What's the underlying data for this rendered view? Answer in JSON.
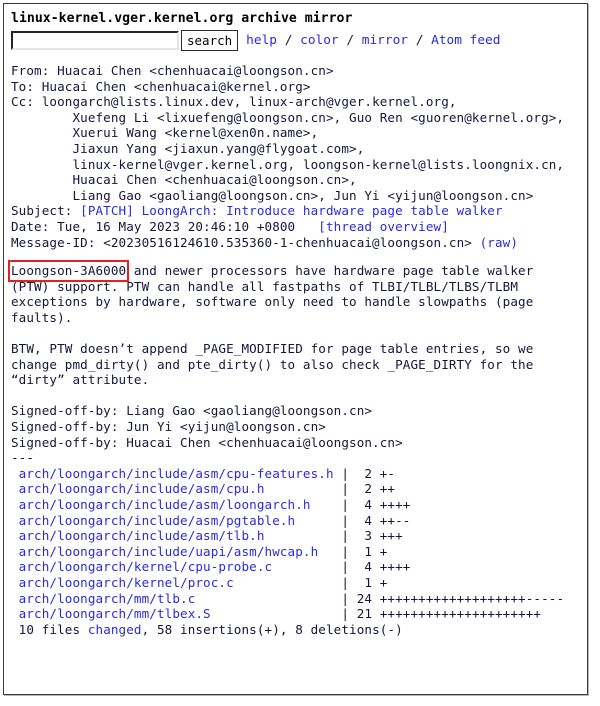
{
  "header": {
    "site_title": "linux-kernel.vger.kernel.org archive mirror",
    "search": {
      "value": "",
      "placeholder": "",
      "button_label": "search"
    },
    "links": [
      {
        "label": "help",
        "name": "help-link"
      },
      {
        "label": "color",
        "name": "color-link"
      },
      {
        "label": "mirror",
        "name": "mirror-link"
      },
      {
        "label": "Atom feed",
        "name": "atom-feed-link"
      }
    ],
    "separator": " / "
  },
  "mail": {
    "from_label": "From: ",
    "from_value": "Huacai Chen <chenhuacai@loongson.cn>",
    "to_label": "To: ",
    "to_value": "Huacai Chen <chenhuacai@kernel.org>",
    "cc_label": "Cc: ",
    "cc_lines": [
      "loongarch@lists.linux.dev, linux-arch@vger.kernel.org,",
      "        Xuefeng Li <lixuefeng@loongson.cn>, Guo Ren <guoren@kernel.org>,",
      "        Xuerui Wang <kernel@xen0n.name>,",
      "        Jiaxun Yang <jiaxun.yang@flygoat.com>,",
      "        linux-kernel@vger.kernel.org, loongson-kernel@lists.loongnix.cn,",
      "        Huacai Chen <chenhuacai@loongson.cn>,",
      "        Liang Gao <gaoliang@loongson.cn>, Jun Yi <yijun@loongson.cn>"
    ],
    "subject_label": "Subject: ",
    "subject_value": "[PATCH] LoongArch: Introduce hardware page table walker",
    "date_label": "Date: ",
    "date_value": "Tue, 16 May 2023 20:46:10 +0800",
    "thread_overview_label": "[thread overview]",
    "message_id_label": "Message-ID: ",
    "message_id_value": "<20230516124610.535360-1-chenhuacai@loongson.cn>",
    "raw_label": "(raw)"
  },
  "body": {
    "highlight_text": "Loongson-3A6000",
    "paragraph1_rest": " and newer processors have hardware page table walker",
    "paragraph1_lines": [
      "(PTW) support. PTW can handle all fastpaths of TLBI/TLBL/TLBS/TLBM",
      "exceptions by hardware, software only need to handle slowpaths (page",
      "faults)."
    ],
    "paragraph2_lines": [
      "BTW, PTW doesn’t append _PAGE_MODIFIED for page table entries, so we",
      "change pmd_dirty() and pte_dirty() to also check _PAGE_DIRTY for the",
      "“dirty” attribute."
    ],
    "signoff_lines": [
      "Signed-off-by: Liang Gao <gaoliang@loongson.cn>",
      "Signed-off-by: Jun Yi <yijun@loongson.cn>",
      "Signed-off-by: Huacai Chen <chenhuacai@loongson.cn>"
    ],
    "separator": "---"
  },
  "diffstat": {
    "files": [
      {
        "path": "arch/loongarch/include/asm/cpu-features.h",
        "count": "2",
        "bar": "+-"
      },
      {
        "path": "arch/loongarch/include/asm/cpu.h",
        "count": "2",
        "bar": "++"
      },
      {
        "path": "arch/loongarch/include/asm/loongarch.h",
        "count": "4",
        "bar": "++++"
      },
      {
        "path": "arch/loongarch/include/asm/pgtable.h",
        "count": "4",
        "bar": "++--"
      },
      {
        "path": "arch/loongarch/include/asm/tlb.h",
        "count": "3",
        "bar": "+++"
      },
      {
        "path": "arch/loongarch/include/uapi/asm/hwcap.h",
        "count": "1",
        "bar": "+"
      },
      {
        "path": "arch/loongarch/kernel/cpu-probe.c",
        "count": "4",
        "bar": "++++"
      },
      {
        "path": "arch/loongarch/kernel/proc.c",
        "count": "1",
        "bar": "+"
      },
      {
        "path": "arch/loongarch/mm/tlb.c",
        "count": "24",
        "bar": "+++++++++++++++++++-----"
      },
      {
        "path": "arch/loongarch/mm/tlbex.S",
        "count": "21",
        "bar": "+++++++++++++++++++++"
      }
    ],
    "summary_prefix": "10 files ",
    "summary_link": "changed",
    "summary_suffix": ", 58 insertions(+), 8 deletions(-)"
  },
  "colors": {
    "link": "#2b2bdd",
    "text": "#16163c",
    "highlight_box": "#e52020",
    "frame": "#3b3b3b"
  }
}
